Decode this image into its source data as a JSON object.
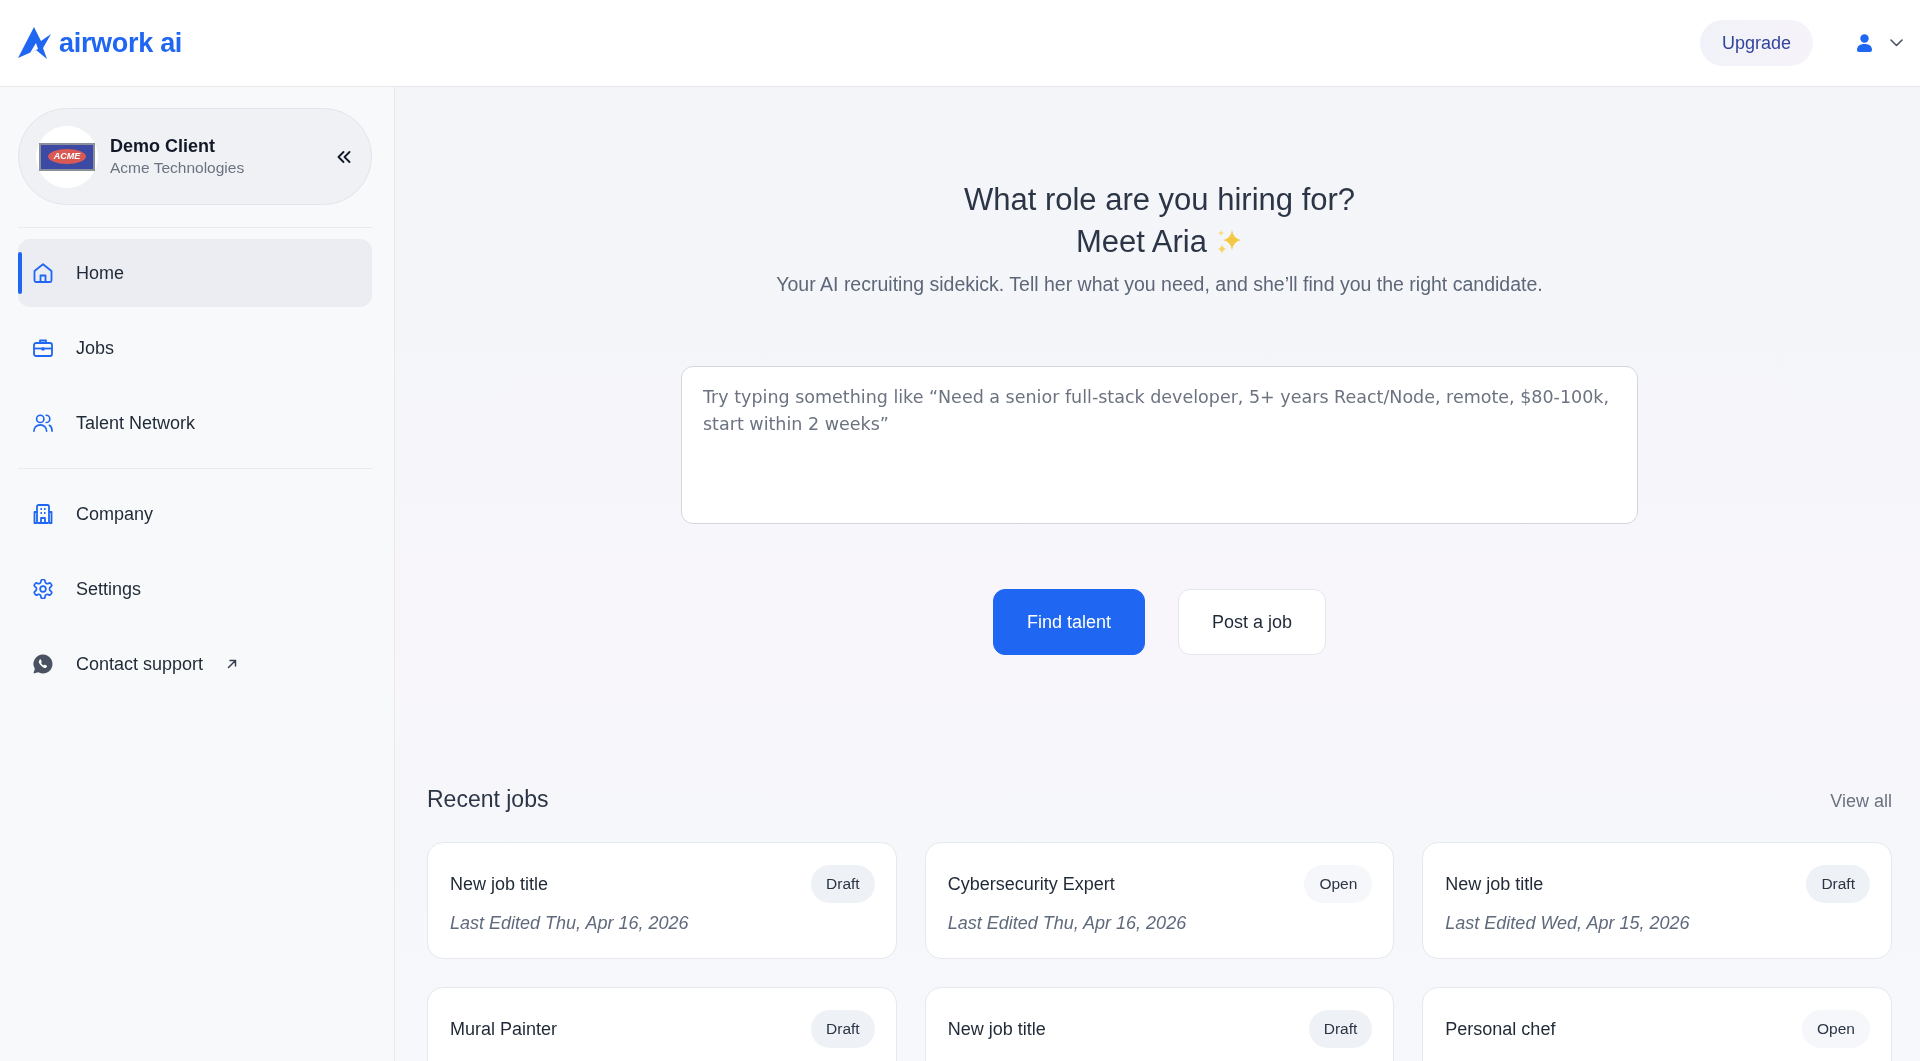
{
  "header": {
    "logo_text": "airwork ai",
    "upgrade_button": "Upgrade"
  },
  "sidebar": {
    "client": {
      "name": "Demo Client",
      "company": "Acme Technologies",
      "logo_text": "ACME"
    },
    "nav_sections": [
      {
        "items": [
          {
            "label": "Home",
            "selected": true,
            "external": false
          },
          {
            "label": "Jobs",
            "selected": false,
            "external": false
          },
          {
            "label": "Talent Network",
            "selected": false,
            "external": false
          }
        ]
      },
      {
        "items": [
          {
            "label": "Company",
            "selected": false,
            "external": false
          },
          {
            "label": "Settings",
            "selected": false,
            "external": false
          },
          {
            "label": "Contact support",
            "selected": false,
            "external": true
          }
        ]
      }
    ]
  },
  "hero": {
    "title": "What role are you hiring for?",
    "subtitle": "Meet Aria",
    "tagline": "Your AI recruiting sidekick. Tell her what you need, and she’ll find you the right candidate.",
    "prompt": {
      "placeholder": "Try typing something like “Need a senior full-stack developer, 5+ years React/Node, remote, $80-100k, start within 2 weeks”"
    },
    "buttons": [
      {
        "label": "Find talent",
        "kind": "primary"
      },
      {
        "label": "Post a job",
        "kind": "secondary"
      }
    ]
  },
  "recent_jobs": {
    "title": "Recent jobs",
    "view_all": "View all",
    "jobs": [
      {
        "title": "New job title",
        "status": "Draft",
        "kind": "draft",
        "edited": "Last Edited Thu, Apr 16, 2026"
      },
      {
        "title": "Cybersecurity Expert",
        "status": "Open",
        "kind": "open",
        "edited": "Last Edited Thu, Apr 16, 2026"
      },
      {
        "title": "New job title",
        "status": "Draft",
        "kind": "draft",
        "edited": "Last Edited Wed, Apr 15, 2026"
      },
      {
        "title": "Mural Painter",
        "status": "Draft",
        "kind": "draft"
      },
      {
        "title": "New job title",
        "status": "Draft",
        "kind": "draft"
      },
      {
        "title": "Personal chef",
        "status": "Open",
        "kind": "open"
      }
    ]
  }
}
